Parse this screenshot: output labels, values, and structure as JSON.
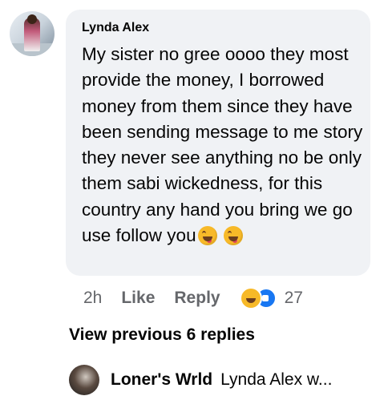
{
  "comment": {
    "author": "Lynda Alex",
    "text": "My sister no gree oooo they most provide the money, I borrowed money from them since they have been sending message to me story they never see anything no be only them sabi wickedness, for this country any hand you bring we go use follow you",
    "emojis": [
      "grinning-squinting-tongue-face-icon",
      "grinning-squinting-tongue-face-icon"
    ],
    "time": "2h",
    "like_label": "Like",
    "reply_label": "Reply",
    "reaction_icons": [
      "haha-reaction-icon",
      "like-reaction-icon"
    ],
    "reaction_count": "27"
  },
  "view_previous": "View previous 6 replies",
  "reply_preview": {
    "author": "Loner's Wrld",
    "text": "Lynda Alex w..."
  },
  "colors": {
    "bubble_bg": "#f0f2f5",
    "meta_text": "#65676b",
    "like_blue": "#1877f2",
    "haha_yellow": "#f7b928"
  }
}
